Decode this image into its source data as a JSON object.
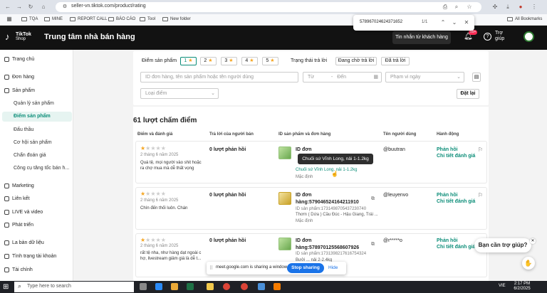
{
  "browser": {
    "url": "seller-vn.tiktok.com/product/rating",
    "bookmarks": [
      "TQA",
      "MINE",
      "REPORT CALL",
      "BÁO CÁO",
      "Tool",
      "New folder"
    ],
    "all_bookmarks": "All Bookmarks",
    "find": {
      "query": "578967024624371652",
      "count": "1/1"
    }
  },
  "header": {
    "logo_line1": "TikTok",
    "logo_line2": "Shop",
    "title": "Trung tâm nhà bán hàng",
    "chat_button": "Tin nhắn từ khách hàng",
    "badge": "99+",
    "help": "Trợ giúp"
  },
  "sidebar": {
    "items": [
      {
        "label": "Trang chủ",
        "icon": "home-icon"
      },
      {
        "label": "Đơn hàng",
        "icon": "order-icon"
      },
      {
        "label": "Sản phẩm",
        "icon": "product-icon"
      },
      {
        "label": "Marketing",
        "icon": "marketing-icon"
      },
      {
        "label": "Liên kết",
        "icon": "link-icon"
      },
      {
        "label": "LIVE và video",
        "icon": "video-icon"
      },
      {
        "label": "Phát triển",
        "icon": "growth-icon"
      },
      {
        "label": "La bàn dữ liệu",
        "icon": "compass-icon"
      },
      {
        "label": "Tình trạng tài khoản",
        "icon": "account-icon"
      },
      {
        "label": "Tài chính",
        "icon": "finance-icon"
      }
    ],
    "sub_items": [
      "Quản lý sản phẩm",
      "Điểm sản phẩm",
      "Đấu thầu",
      "Cơ hội sản phẩm",
      "Chẩn đoán giá",
      "Công cụ tăng tốc bán h..."
    ]
  },
  "filters": {
    "score_label": "Điểm sản phẩm",
    "scores": [
      "1",
      "2",
      "3",
      "4",
      "5"
    ],
    "reply_label": "Trạng thái trả lời",
    "reply_options": [
      "Đang chờ trả lời",
      "Đã trả lời"
    ],
    "search_placeholder": "ID đơn hàng, tên sản phẩm hoặc tên người dùng",
    "date_from": "Từ",
    "date_to": "Đến",
    "price_placeholder": "Phạm vi ngày",
    "rating_type": "Loại điểm",
    "reset": "Đặt lại"
  },
  "list": {
    "count_title": "61 lượt chấm điểm",
    "columns": [
      "Điểm và đánh giá",
      "Trả lời của người bán",
      "ID sản phẩm và đơn hàng",
      "Tên người dùng",
      "Hành động"
    ],
    "rows": [
      {
        "stars": 1,
        "date": "2 tháng 6 năm 2025",
        "review": "Quá tệ, mọi người vào shit hoặc ra chợ mua mà dễ thất vọng",
        "reply": "0 lượt phản hồi",
        "order_label": "ID đơn",
        "product_name": "Chuối sứ Vĩnh Long, nải 1-1.2kg",
        "variant": "Mặc định",
        "user": "@buutran",
        "action1": "Phản hồi",
        "action2": "Chi tiết đánh giá"
      },
      {
        "stars": 1,
        "date": "2 tháng 6 năm 2025",
        "review": "Chín đến thối luôn. Chán",
        "reply": "0 lượt phản hồi",
        "order_label": "ID đơn",
        "order_id": "hàng:579046524164211910",
        "product_id": "ID sản phẩm:1731498705437230740",
        "product_name": "Thơm ( Dứa ) Cầu Đúc - Hậu Giang, Trái ...",
        "variant": "Mặc định",
        "user": "@leuyenvo",
        "action1": "Phản hồi",
        "action2": "Chi tiết đánh giá"
      },
      {
        "stars": 1,
        "date": "2 tháng 6 năm 2025",
        "review": "rất tệ nha, như hàng dạt ngoài c hợ, livestream giảm giá là dễ t...",
        "reply": "0 lượt phản hồi",
        "order_label": "ID đơn",
        "order_id": "hàng:578970125568607926",
        "product_id": "ID sản phẩm:1731398217616754324",
        "product_name": "Bưởi ... nải 2-2.4kg",
        "user": "@r*****o",
        "action1": "Phản hồi",
        "action2": "Chi tiết đánh giá"
      }
    ]
  },
  "tooltip": "Chuối sứ Vĩnh Long, nải 1-1.2kg",
  "help_bubble": "Bạn cần trợ giúp?",
  "share_bar": {
    "text": "meet.google.com is sharing a window.",
    "stop": "Stop sharing",
    "hide": "Hide"
  },
  "taskbar": {
    "search_placeholder": "Type here to search",
    "time": "2:17 PM",
    "date": "6/2/2025",
    "lang": "VIE"
  },
  "colors": {
    "accent": "#0b8d78",
    "star": "#f5a623",
    "header": "#121212",
    "danger": "#fe2c55"
  }
}
